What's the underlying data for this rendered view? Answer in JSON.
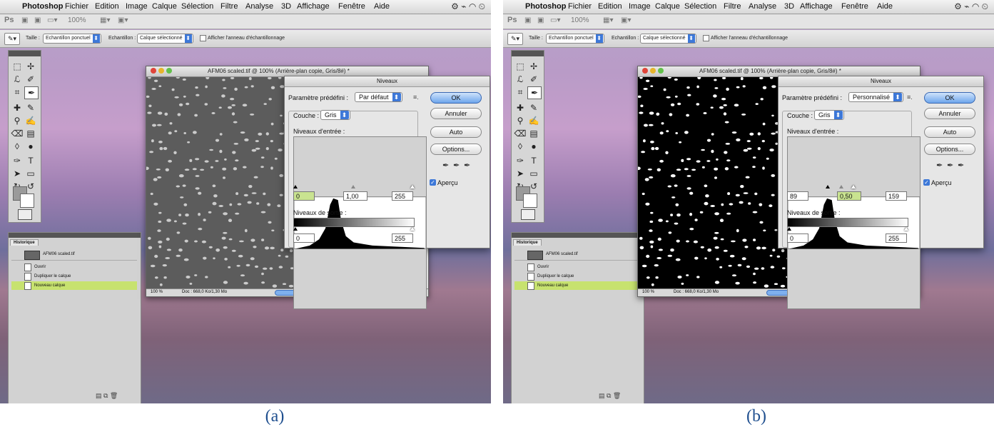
{
  "menubar": {
    "app": "Photoshop",
    "items": [
      "Fichier",
      "Edition",
      "Image",
      "Calque",
      "Sélection",
      "Filtre",
      "Analyse",
      "3D",
      "Affichage",
      "Fenêtre",
      "Aide"
    ]
  },
  "appbar": {
    "ps_label": "Ps",
    "zoom": "100%"
  },
  "options_bar": {
    "taille_label": "Taille :",
    "taille_value": "Echantillon ponctuel",
    "echantillon_label": "Echantillon :",
    "echantillon_value": "Calque sélectionné",
    "ring_label": "Afficher l'anneau d'échantillonnage"
  },
  "history": {
    "tab": "Historique",
    "snapshot": "AFM06 scaled.tif",
    "items": [
      "Ouvrir",
      "Dupliquer le calque",
      "Nouveau calque"
    ]
  },
  "document": {
    "title": "AFM06 scaled.tif @ 100% (Arrière-plan copie, Gris/8#) *",
    "zoom": "100 %",
    "doc_info": "Doc : 668,0 Ko/1,30 Mo"
  },
  "dialog": {
    "title": "Niveaux",
    "preset_label": "Paramètre prédéfini :",
    "channel_label": "Couche :",
    "channel_value": "Gris",
    "input_label": "Niveaux d'entrée :",
    "output_label": "Niveaux de sortie :",
    "ok": "OK",
    "cancel": "Annuler",
    "auto": "Auto",
    "options": "Options...",
    "preview": "Aperçu"
  },
  "panels": [
    {
      "caption": "(a)",
      "preset_value": "Par défaut",
      "input_black": "0",
      "input_gamma": "1,00",
      "input_white": "255",
      "output_black": "0",
      "output_white": "255"
    },
    {
      "caption": "(b)",
      "preset_value": "Personnalisé",
      "input_black": "89",
      "input_gamma": "0,50",
      "input_white": "159",
      "output_black": "0",
      "output_white": "255"
    }
  ]
}
